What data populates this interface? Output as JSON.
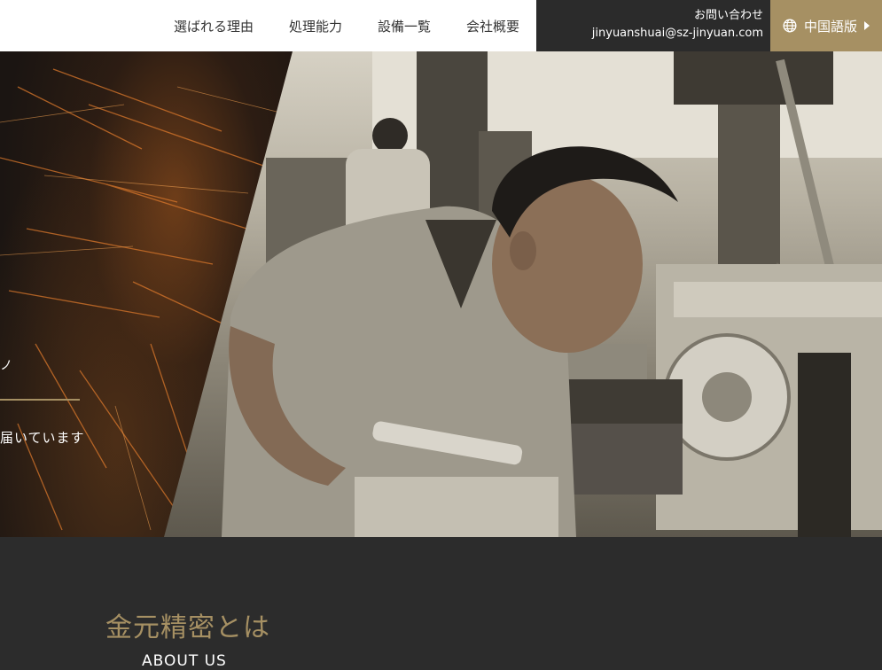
{
  "nav": {
    "items": [
      {
        "label": "選ばれる理由"
      },
      {
        "label": "処理能力"
      },
      {
        "label": "設備一覧"
      },
      {
        "label": "会社概要"
      }
    ]
  },
  "contact": {
    "label": "お問い合わせ",
    "email": "jinyuanshuai@sz-jinyuan.com"
  },
  "language": {
    "label": "中国語版",
    "icon": "globe-icon"
  },
  "hero": {
    "tag": "ノ",
    "subtitle": "届いています"
  },
  "about": {
    "title": "金元精密とは",
    "subtitle": "ABOUT US"
  },
  "colors": {
    "accent": "#a69063",
    "dark": "#2c2c2c",
    "header_white": "#ffffff"
  }
}
